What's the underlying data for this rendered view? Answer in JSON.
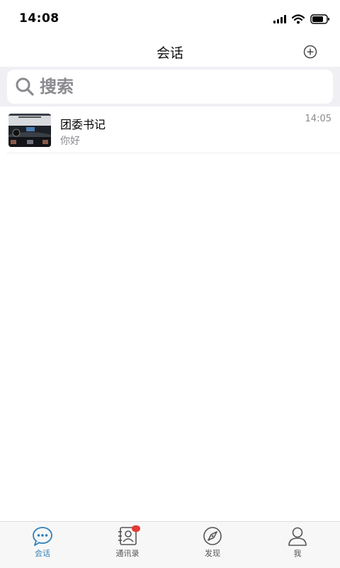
{
  "status_bar": {
    "time": "14:08"
  },
  "nav": {
    "title": "会话",
    "add_icon": "plus-circle-icon"
  },
  "search": {
    "placeholder": "搜索",
    "icon": "search-icon"
  },
  "conversations": [
    {
      "name": "团委书记",
      "message": "你好",
      "time": "14:05",
      "avatar": "car-interior-image"
    }
  ],
  "tabs": [
    {
      "label": "会话",
      "icon": "chat-bubble-icon",
      "active": true
    },
    {
      "label": "通讯录",
      "icon": "contacts-icon",
      "badge": true
    },
    {
      "label": "发现",
      "icon": "compass-icon"
    },
    {
      "label": "我",
      "icon": "person-icon"
    }
  ],
  "colors": {
    "accent": "#2e7fb8",
    "badge": "#e53935",
    "search_bg": "#efeff4"
  }
}
